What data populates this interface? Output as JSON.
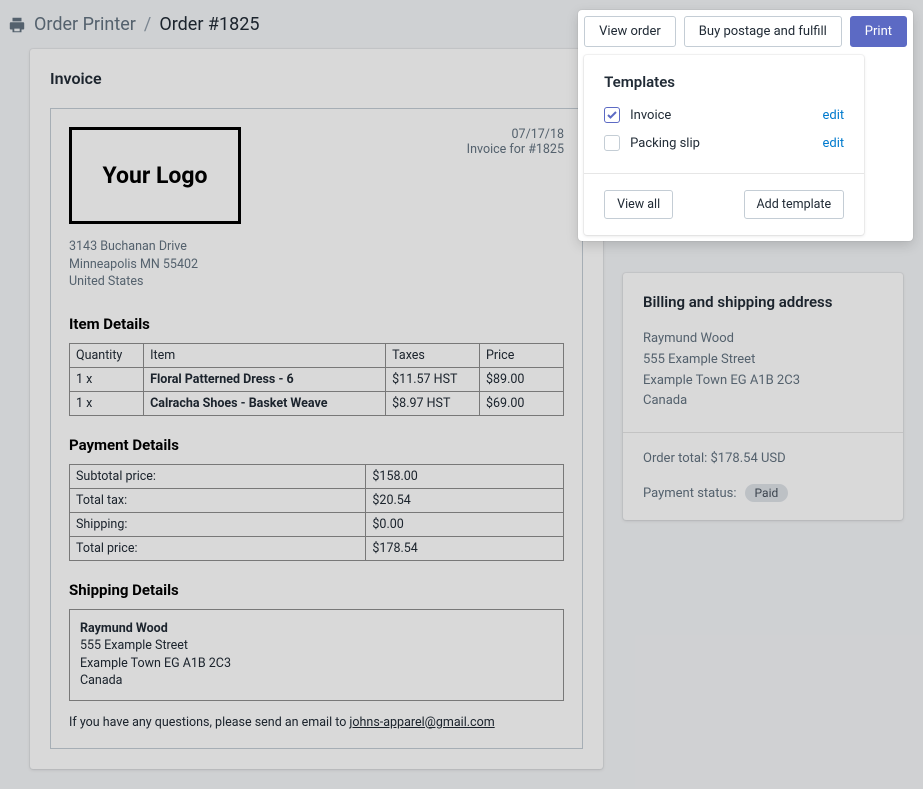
{
  "breadcrumb": {
    "app": "Order Printer",
    "separator": "/",
    "current": "Order #1825"
  },
  "actions": {
    "view_order": "View order",
    "buy_postage": "Buy postage and fulfill",
    "print": "Print"
  },
  "invoice": {
    "card_title": "Invoice",
    "logo_text": "Your Logo",
    "date": "07/17/18",
    "for_label": "Invoice for #1825",
    "shop_address": {
      "line1": "3143 Buchanan Drive",
      "line2": "Minneapolis MN 55402",
      "line3": "United States"
    },
    "item_details_heading": "Item Details",
    "item_headers": {
      "qty": "Quantity",
      "item": "Item",
      "taxes": "Taxes",
      "price": "Price"
    },
    "items": [
      {
        "qty": "1 x",
        "name": "Floral Patterned Dress - 6",
        "taxes": "$11.57 HST",
        "price": "$89.00"
      },
      {
        "qty": "1 x",
        "name": "Calracha Shoes - Basket Weave",
        "taxes": "$8.97 HST",
        "price": "$69.00"
      }
    ],
    "payment_heading": "Payment Details",
    "payment": [
      {
        "label": "Subtotal price:",
        "value": "$158.00",
        "bold": false
      },
      {
        "label": "Total tax:",
        "value": "$20.54",
        "bold": false
      },
      {
        "label": "Shipping:",
        "value": "$0.00",
        "bold": false
      },
      {
        "label": "Total price:",
        "value": "$178.54",
        "bold": true
      }
    ],
    "shipping_heading": "Shipping Details",
    "shipping": {
      "name": "Raymund Wood",
      "line1": "555 Example Street",
      "line2": "Example Town EG A1B 2C3",
      "line3": "Canada"
    },
    "footer_prefix": "If you have any questions, please send an email to ",
    "footer_email": "johns-apparel@gmail.com"
  },
  "templates": {
    "heading": "Templates",
    "items": [
      {
        "label": "Invoice",
        "checked": true
      },
      {
        "label": "Packing slip",
        "checked": false
      }
    ],
    "edit": "edit",
    "view_all": "View all",
    "add_template": "Add template"
  },
  "billing": {
    "heading": "Billing and shipping address",
    "name": "Raymund Wood",
    "line1": "555 Example Street",
    "line2": "Example Town EG A1B 2C3",
    "line3": "Canada"
  },
  "summary": {
    "order_total_label": "Order total: ",
    "order_total_value": "$178.54 USD",
    "payment_status_label": "Payment status:",
    "payment_status_value": "Paid"
  }
}
